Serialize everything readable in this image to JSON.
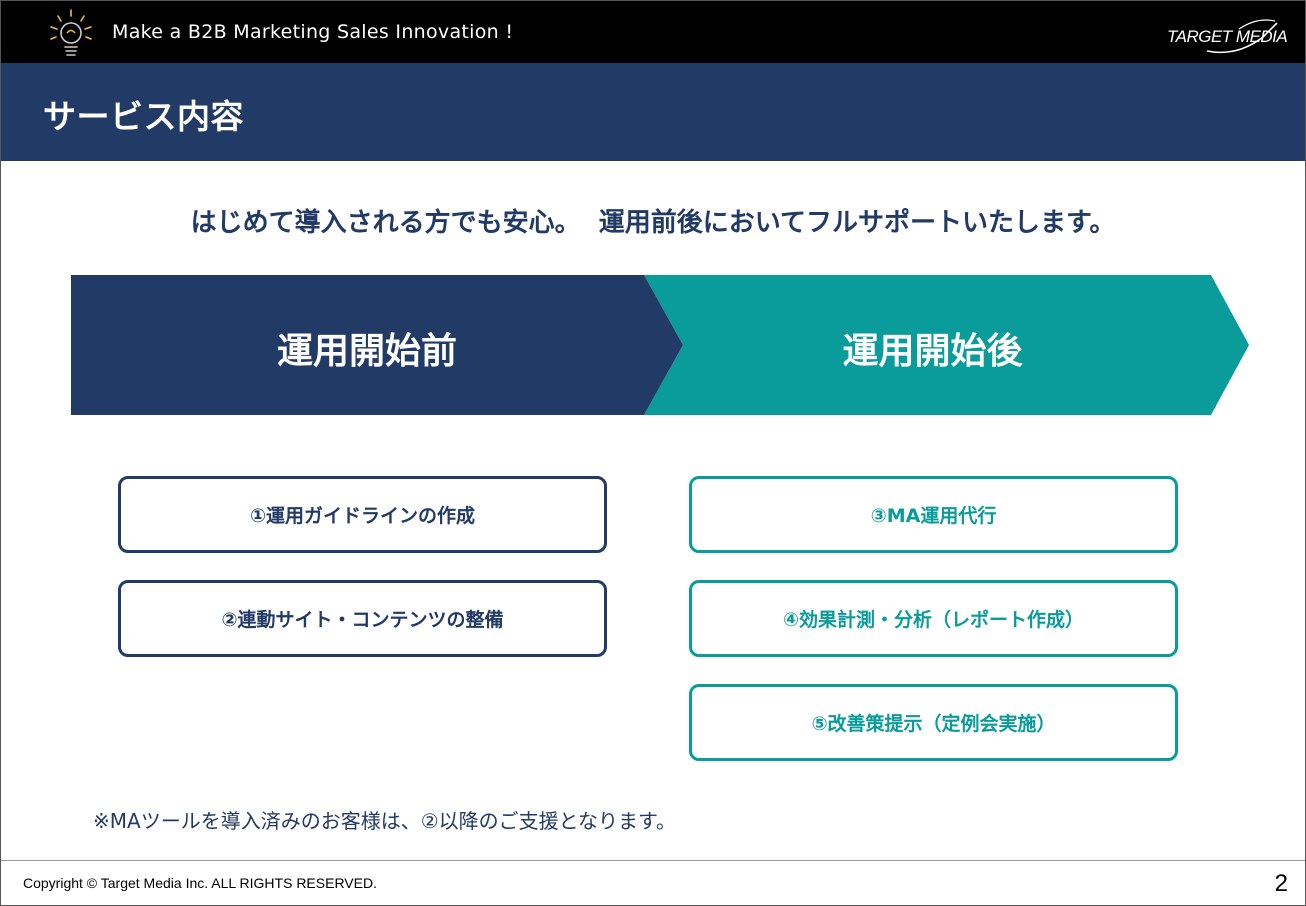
{
  "header": {
    "tagline": "Make a B2B Marketing Sales Innovation !",
    "logo_text": "TARGET MEDIA"
  },
  "title": "サービス内容",
  "lead": "はじめて導入される方でも安心。  運用前後においてフルサポートいたします。",
  "phases": {
    "before": "運用開始前",
    "after": "運用開始後"
  },
  "colors": {
    "navy": "#223a66",
    "teal": "#0a9b9b",
    "black": "#000000"
  },
  "services_before": [
    "①運用ガイドラインの作成",
    "②連動サイト・コンテンツの整備"
  ],
  "services_after": [
    "③MA運用代行",
    "④効果計測・分析（レポート作成）",
    "⑤改善策提示（定例会実施）"
  ],
  "note": "※MAツールを導入済みのお客様は、②以降のご支援となります。",
  "footer": {
    "copyright": "Copyright © Target Media Inc. ALL RIGHTS RESERVED.",
    "page_number": "2"
  }
}
